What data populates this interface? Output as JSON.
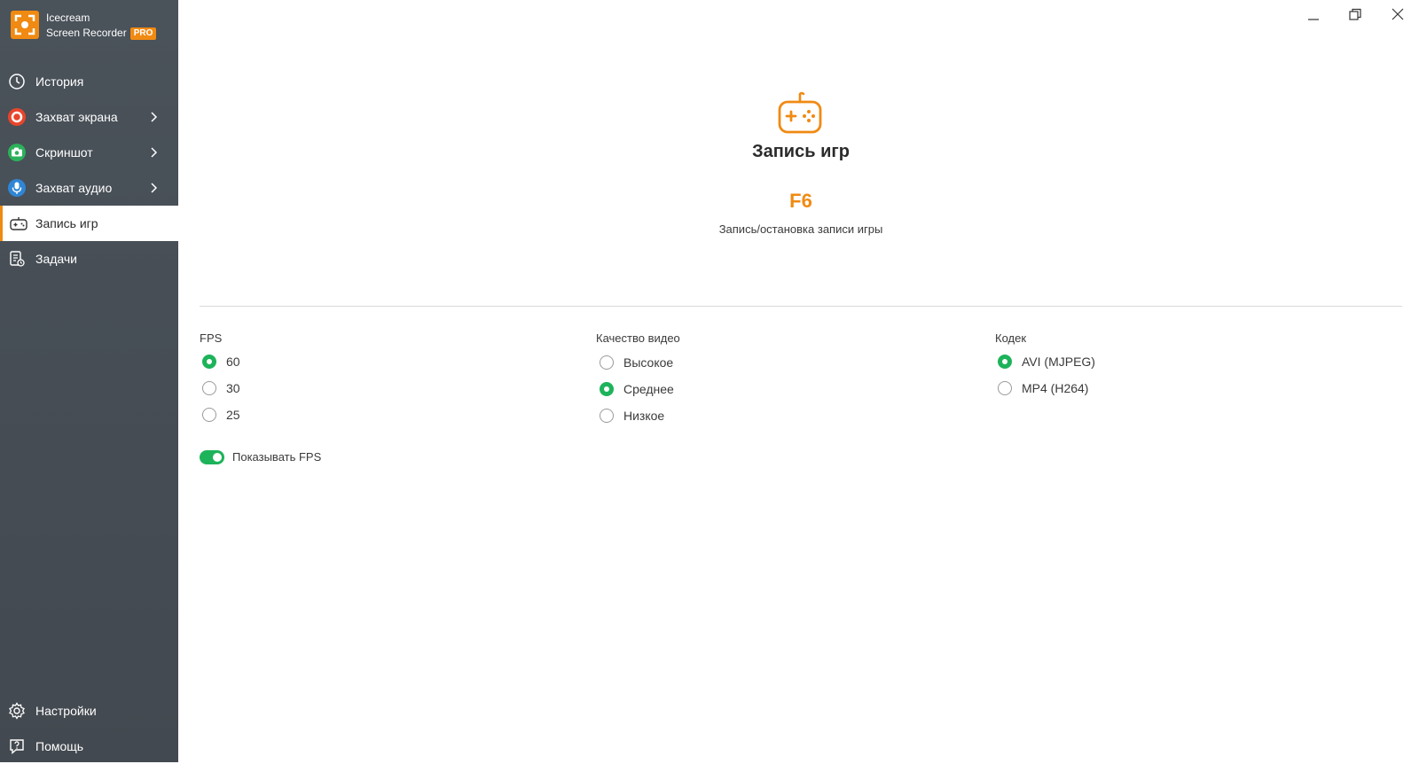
{
  "app": {
    "name_line1": "Icecream",
    "name_line2": "Screen Recorder",
    "badge": "PRO",
    "accent_color": "#f08a12",
    "success_color": "#1db35a"
  },
  "sidebar": {
    "items": [
      {
        "label": "История",
        "icon": "history-clock-icon"
      },
      {
        "label": "Захват экрана",
        "icon": "screen-capture-icon",
        "icon_color": "#e8452c",
        "has_submenu": true
      },
      {
        "label": "Скриншот",
        "icon": "camera-icon",
        "icon_color": "#2bb15a",
        "has_submenu": true
      },
      {
        "label": "Захват аудио",
        "icon": "microphone-icon",
        "icon_color": "#2f86d6",
        "has_submenu": true
      },
      {
        "label": "Запись игр",
        "icon": "gamepad-icon",
        "active": true
      },
      {
        "label": "Задачи",
        "icon": "tasks-icon"
      }
    ],
    "bottom": [
      {
        "label": "Настройки",
        "icon": "gear-icon"
      },
      {
        "label": "Помощь",
        "icon": "help-icon"
      }
    ]
  },
  "main": {
    "title": "Запись игр",
    "hotkey": "F6",
    "hotkey_description": "Запись/остановка записи игры",
    "fps": {
      "title": "FPS",
      "options": [
        "60",
        "30",
        "25"
      ],
      "selected": "60"
    },
    "quality": {
      "title": "Качество видео",
      "options": [
        "Высокое",
        "Среднее",
        "Низкое"
      ],
      "selected": "Среднее"
    },
    "codec": {
      "title": "Кодек",
      "options": [
        "AVI (MJPEG)",
        "MP4 (H264)"
      ],
      "selected": "AVI (MJPEG)"
    },
    "show_fps": {
      "label": "Показывать FPS",
      "enabled": true
    }
  }
}
